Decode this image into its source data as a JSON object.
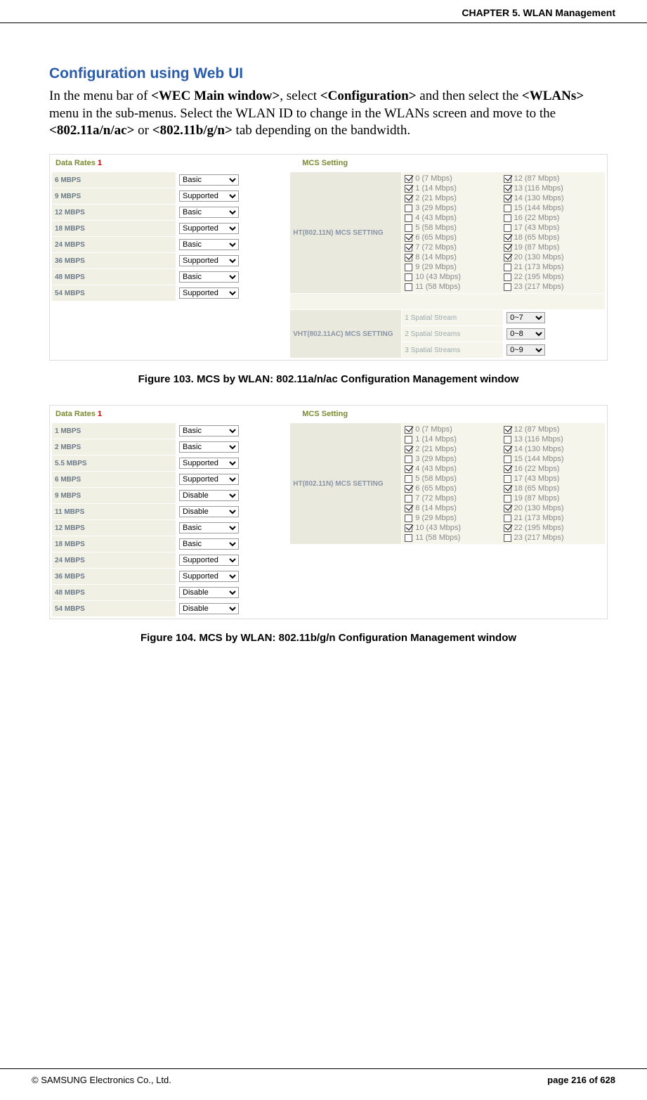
{
  "header": {
    "chapter": "CHAPTER 5. WLAN Management"
  },
  "section": {
    "heading": "Configuration using Web UI",
    "para_parts": [
      "In the menu bar of ",
      "<WEC Main window>",
      ", select ",
      "<Configuration>",
      " and then select the ",
      "<WLANs>",
      " menu in the sub-menus. Select the WLAN ID to change in the WLANs screen and move to the ",
      "<802.11a/n/ac>",
      " or ",
      "<802.11b/g/n>",
      " tab depending on the bandwidth."
    ]
  },
  "labels": {
    "data_rates": "Data Rates ",
    "red1": "1",
    "mcs_setting": "MCS Setting",
    "ht_setting": "HT(802.11N) MCS SETTING",
    "vht_setting": "VHT(802.11AC) MCS SETTING",
    "spatial1": "1 Spatial Stream",
    "spatial2": "2 Spatial Streams",
    "spatial3": "3 Spatial Streams"
  },
  "fig103": {
    "caption": "Figure 103. MCS by WLAN: 802.11a/n/ac Configuration Management window",
    "rates": [
      {
        "name": "6 MBPS",
        "value": "Basic"
      },
      {
        "name": "9 MBPS",
        "value": "Supported"
      },
      {
        "name": "12 MBPS",
        "value": "Basic"
      },
      {
        "name": "18 MBPS",
        "value": "Supported"
      },
      {
        "name": "24 MBPS",
        "value": "Basic"
      },
      {
        "name": "36 MBPS",
        "value": "Supported"
      },
      {
        "name": "48 MBPS",
        "value": "Basic"
      },
      {
        "name": "54 MBPS",
        "value": "Supported"
      }
    ],
    "mcs_left": [
      {
        "label": "0 (7 Mbps)",
        "on": true
      },
      {
        "label": "1 (14 Mbps)",
        "on": true
      },
      {
        "label": "2 (21 Mbps)",
        "on": true
      },
      {
        "label": "3 (29 Mbps)",
        "on": false
      },
      {
        "label": "4 (43 Mbps)",
        "on": false
      },
      {
        "label": "5 (58 Mbps)",
        "on": false
      },
      {
        "label": "6 (65 Mbps)",
        "on": true
      },
      {
        "label": "7 (72 Mbps)",
        "on": true
      },
      {
        "label": "8 (14 Mbps)",
        "on": true
      },
      {
        "label": "9 (29 Mbps)",
        "on": false
      },
      {
        "label": "10 (43 Mbps)",
        "on": false
      },
      {
        "label": "11 (58 Mbps)",
        "on": false
      }
    ],
    "mcs_right": [
      {
        "label": "12 (87 Mbps)",
        "on": true
      },
      {
        "label": "13 (116 Mbps)",
        "on": true
      },
      {
        "label": "14 (130 Mbps)",
        "on": true
      },
      {
        "label": "15 (144 Mbps)",
        "on": false
      },
      {
        "label": "16 (22 Mbps)",
        "on": false
      },
      {
        "label": "17 (43 Mbps)",
        "on": false
      },
      {
        "label": "18 (65 Mbps)",
        "on": true
      },
      {
        "label": "19 (87 Mbps)",
        "on": true
      },
      {
        "label": "20 (130 Mbps)",
        "on": true
      },
      {
        "label": "21 (173 Mbps)",
        "on": false
      },
      {
        "label": "22 (195 Mbps)",
        "on": false
      },
      {
        "label": "23 (217 Mbps)",
        "on": false
      }
    ],
    "vht": [
      {
        "value": "0~7"
      },
      {
        "value": "0~8"
      },
      {
        "value": "0~9"
      }
    ]
  },
  "fig104": {
    "caption": "Figure 104. MCS by WLAN: 802.11b/g/n Configuration Management window",
    "rates": [
      {
        "name": "1 MBPS",
        "value": "Basic"
      },
      {
        "name": "2 MBPS",
        "value": "Basic"
      },
      {
        "name": "5.5 MBPS",
        "value": "Supported"
      },
      {
        "name": "6 MBPS",
        "value": "Supported"
      },
      {
        "name": "9 MBPS",
        "value": "Disable"
      },
      {
        "name": "11 MBPS",
        "value": "Disable"
      },
      {
        "name": "12 MBPS",
        "value": "Basic"
      },
      {
        "name": "18 MBPS",
        "value": "Basic"
      },
      {
        "name": "24 MBPS",
        "value": "Supported"
      },
      {
        "name": "36 MBPS",
        "value": "Supported"
      },
      {
        "name": "48 MBPS",
        "value": "Disable"
      },
      {
        "name": "54 MBPS",
        "value": "Disable"
      }
    ],
    "mcs_left": [
      {
        "label": "0 (7 Mbps)",
        "on": true
      },
      {
        "label": "1 (14 Mbps)",
        "on": false
      },
      {
        "label": "2 (21 Mbps)",
        "on": true
      },
      {
        "label": "3 (29 Mbps)",
        "on": false
      },
      {
        "label": "4 (43 Mbps)",
        "on": true
      },
      {
        "label": "5 (58 Mbps)",
        "on": false
      },
      {
        "label": "6 (65 Mbps)",
        "on": true
      },
      {
        "label": "7 (72 Mbps)",
        "on": false
      },
      {
        "label": "8 (14 Mbps)",
        "on": true
      },
      {
        "label": "9 (29 Mbps)",
        "on": false
      },
      {
        "label": "10 (43 Mbps)",
        "on": true
      },
      {
        "label": "11 (58 Mbps)",
        "on": false
      }
    ],
    "mcs_right": [
      {
        "label": "12 (87 Mbps)",
        "on": true
      },
      {
        "label": "13 (116 Mbps)",
        "on": false
      },
      {
        "label": "14 (130 Mbps)",
        "on": true
      },
      {
        "label": "15 (144 Mbps)",
        "on": false
      },
      {
        "label": "16 (22 Mbps)",
        "on": true
      },
      {
        "label": "17 (43 Mbps)",
        "on": false
      },
      {
        "label": "18 (65 Mbps)",
        "on": true
      },
      {
        "label": "19 (87 Mbps)",
        "on": false
      },
      {
        "label": "20 (130 Mbps)",
        "on": true
      },
      {
        "label": "21 (173 Mbps)",
        "on": false
      },
      {
        "label": "22 (195 Mbps)",
        "on": true
      },
      {
        "label": "23 (217 Mbps)",
        "on": false
      }
    ]
  },
  "footer": {
    "copyright": "© SAMSUNG Electronics Co., Ltd.",
    "page": "page 216 of 628"
  }
}
